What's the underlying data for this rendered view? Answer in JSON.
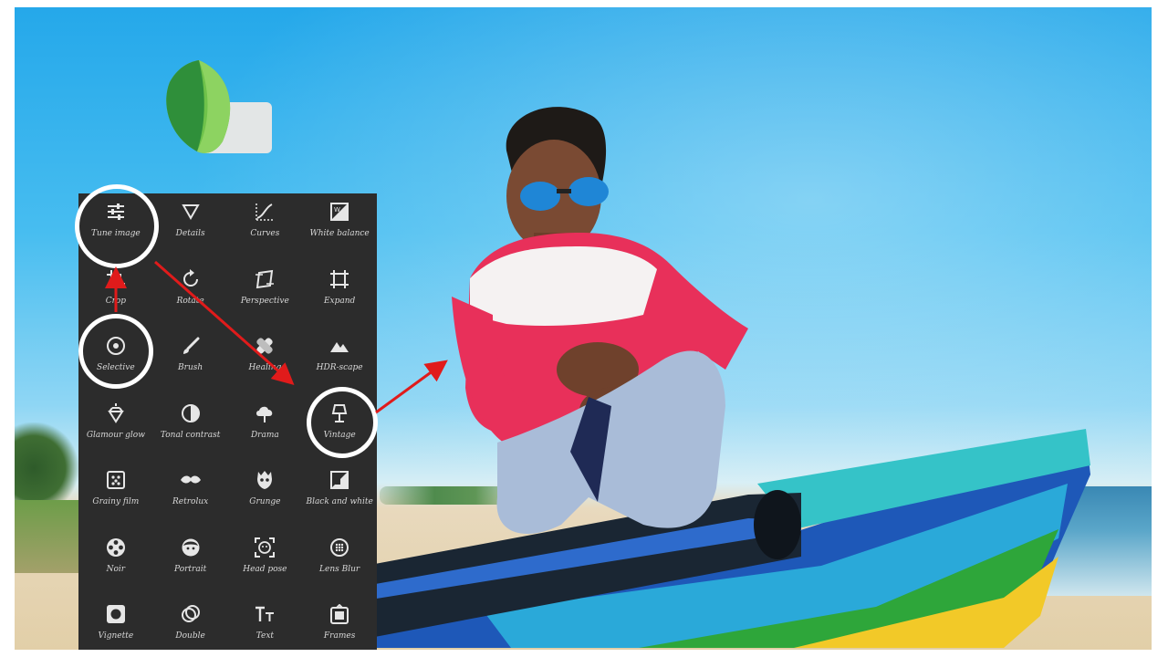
{
  "tools": [
    {
      "label": "Tune image",
      "icon": "tune-icon"
    },
    {
      "label": "Details",
      "icon": "details-triangle-icon"
    },
    {
      "label": "Curves",
      "icon": "curves-icon"
    },
    {
      "label": "White balance",
      "icon": "white-balance-icon"
    },
    {
      "label": "Crop",
      "icon": "crop-icon"
    },
    {
      "label": "Rotate",
      "icon": "rotate-icon"
    },
    {
      "label": "Perspective",
      "icon": "perspective-icon"
    },
    {
      "label": "Expand",
      "icon": "expand-icon"
    },
    {
      "label": "Selective",
      "icon": "selective-icon"
    },
    {
      "label": "Brush",
      "icon": "brush-icon"
    },
    {
      "label": "Healing",
      "icon": "healing-icon"
    },
    {
      "label": "HDR-scape",
      "icon": "hdr-mountain-icon"
    },
    {
      "label": "Glamour glow",
      "icon": "glamour-glow-icon"
    },
    {
      "label": "Tonal contrast",
      "icon": "tonal-contrast-icon"
    },
    {
      "label": "Drama",
      "icon": "drama-cloud-icon"
    },
    {
      "label": "Vintage",
      "icon": "vintage-lamp-icon"
    },
    {
      "label": "Grainy film",
      "icon": "grainy-film-icon"
    },
    {
      "label": "Retrolux",
      "icon": "retrolux-mustache-icon"
    },
    {
      "label": "Grunge",
      "icon": "grunge-icon"
    },
    {
      "label": "Black and white",
      "icon": "black-white-icon"
    },
    {
      "label": "Noir",
      "icon": "noir-reel-icon"
    },
    {
      "label": "Portrait",
      "icon": "portrait-face-icon"
    },
    {
      "label": "Head pose",
      "icon": "head-pose-icon"
    },
    {
      "label": "Lens Blur",
      "icon": "lens-blur-icon"
    },
    {
      "label": "Vignette",
      "icon": "vignette-icon"
    },
    {
      "label": "Double",
      "icon": "double-exposure-icon"
    },
    {
      "label": "Text",
      "icon": "text-icon"
    },
    {
      "label": "Frames",
      "icon": "frames-icon"
    }
  ],
  "colors": {
    "panel": "#2c2c2c",
    "label": "#d8d8d8",
    "highlight": "#ffffff",
    "arrow": "#e01b1b",
    "leaf_light": "#6fc24a",
    "leaf_dark": "#2f8f3a"
  }
}
